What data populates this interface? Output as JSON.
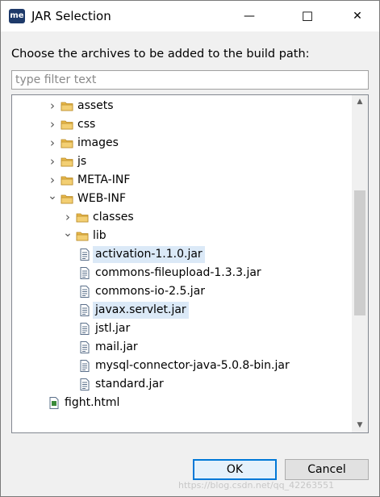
{
  "window": {
    "app_icon_text": "me",
    "title": "JAR Selection",
    "minimize_glyph": "—",
    "maximize_glyph": "☐",
    "close_glyph": "✕"
  },
  "prompt": "Choose the archives to be added to the build path:",
  "filter": {
    "placeholder": "type filter text",
    "value": ""
  },
  "tree": {
    "items": [
      {
        "label": "assets",
        "type": "folder",
        "depth": 0,
        "expanded": false
      },
      {
        "label": "css",
        "type": "folder",
        "depth": 0,
        "expanded": false
      },
      {
        "label": "images",
        "type": "folder",
        "depth": 0,
        "expanded": false
      },
      {
        "label": "js",
        "type": "folder",
        "depth": 0,
        "expanded": false
      },
      {
        "label": "META-INF",
        "type": "folder",
        "depth": 0,
        "expanded": false
      },
      {
        "label": "WEB-INF",
        "type": "folder",
        "depth": 0,
        "expanded": true
      },
      {
        "label": "classes",
        "type": "folder",
        "depth": 1,
        "expanded": false
      },
      {
        "label": "lib",
        "type": "folder",
        "depth": 1,
        "expanded": true
      },
      {
        "label": "activation-1.1.0.jar",
        "type": "jar",
        "depth": 2,
        "selected": true
      },
      {
        "label": "commons-fileupload-1.3.3.jar",
        "type": "jar",
        "depth": 2,
        "selected": false
      },
      {
        "label": "commons-io-2.5.jar",
        "type": "jar",
        "depth": 2,
        "selected": false
      },
      {
        "label": "javax.servlet.jar",
        "type": "jar",
        "depth": 2,
        "selected": true
      },
      {
        "label": "jstl.jar",
        "type": "jar",
        "depth": 2,
        "selected": false
      },
      {
        "label": "mail.jar",
        "type": "jar",
        "depth": 2,
        "selected": false
      },
      {
        "label": "mysql-connector-java-5.0.8-bin.jar",
        "type": "jar",
        "depth": 2,
        "selected": false
      },
      {
        "label": "standard.jar",
        "type": "jar",
        "depth": 2,
        "selected": false
      },
      {
        "label": "fight.html",
        "type": "html",
        "depth": 0,
        "selected": false
      }
    ]
  },
  "buttons": {
    "ok": "OK",
    "cancel": "Cancel"
  },
  "watermark": "https://blog.csdn.net/qq_42263551",
  "colors": {
    "selection": "#dbe9f7",
    "folder": "#e8b84a",
    "ok_border": "#0078d7"
  }
}
